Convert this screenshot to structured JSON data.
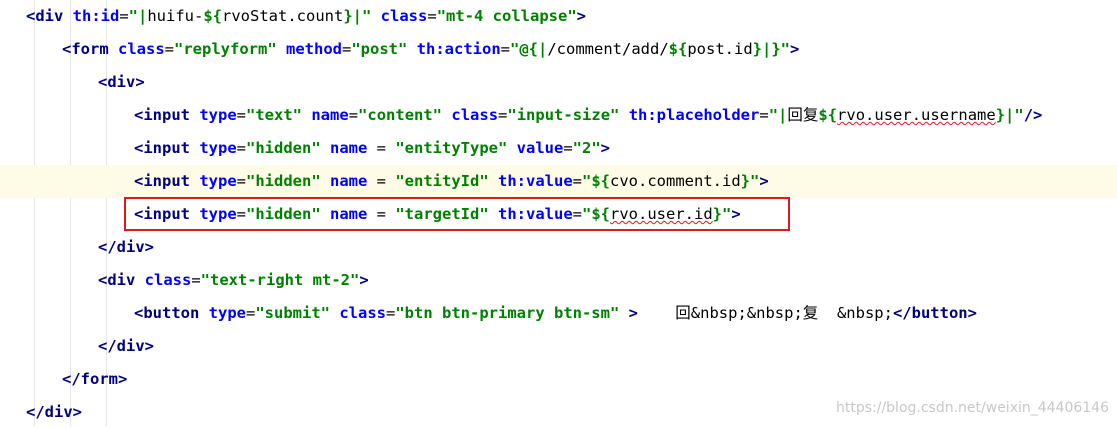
{
  "editor": {
    "lines": [
      {
        "indent": 0,
        "parts": [
          {
            "cls": "tag",
            "text": "<div"
          },
          {
            "cls": "attr",
            "text": " th:id"
          },
          {
            "cls": "plain",
            "text": "="
          },
          {
            "cls": "val",
            "text": "\"|"
          },
          {
            "cls": "expr",
            "text": "huifu-"
          },
          {
            "cls": "val",
            "text": "${"
          },
          {
            "cls": "expr",
            "text": "rvoStat.count"
          },
          {
            "cls": "val",
            "text": "}|\""
          },
          {
            "cls": "attr",
            "text": " class"
          },
          {
            "cls": "plain",
            "text": "="
          },
          {
            "cls": "val",
            "text": "\"mt-4 collapse\""
          },
          {
            "cls": "tag",
            "text": ">"
          }
        ]
      },
      {
        "indent": 1,
        "parts": [
          {
            "cls": "tag",
            "text": "<form"
          },
          {
            "cls": "attr",
            "text": " class"
          },
          {
            "cls": "plain",
            "text": "="
          },
          {
            "cls": "val",
            "text": "\"replyform\""
          },
          {
            "cls": "attr",
            "text": " method"
          },
          {
            "cls": "plain",
            "text": "="
          },
          {
            "cls": "val",
            "text": "\"post\""
          },
          {
            "cls": "attr",
            "text": " th:action"
          },
          {
            "cls": "plain",
            "text": "="
          },
          {
            "cls": "val",
            "text": "\"@{|"
          },
          {
            "cls": "expr",
            "text": "/comment/add/"
          },
          {
            "cls": "val",
            "text": "${"
          },
          {
            "cls": "expr",
            "text": "post.id"
          },
          {
            "cls": "val",
            "text": "}|}\""
          },
          {
            "cls": "tag",
            "text": ">"
          }
        ]
      },
      {
        "indent": 2,
        "parts": [
          {
            "cls": "tag",
            "text": "<div>"
          }
        ]
      },
      {
        "indent": 3,
        "parts": [
          {
            "cls": "tag",
            "text": "<input"
          },
          {
            "cls": "attr",
            "text": " type"
          },
          {
            "cls": "plain",
            "text": "="
          },
          {
            "cls": "val",
            "text": "\"text\""
          },
          {
            "cls": "attr",
            "text": " name"
          },
          {
            "cls": "plain",
            "text": "="
          },
          {
            "cls": "val",
            "text": "\"content\""
          },
          {
            "cls": "attr",
            "text": " class"
          },
          {
            "cls": "plain",
            "text": "="
          },
          {
            "cls": "val",
            "text": "\"input-size\""
          },
          {
            "cls": "attr",
            "text": " th:placeholder"
          },
          {
            "cls": "plain",
            "text": "="
          },
          {
            "cls": "val",
            "text": "\"|"
          },
          {
            "cls": "expr",
            "text": "回复"
          },
          {
            "cls": "val",
            "text": "${"
          },
          {
            "cls": "expr squig",
            "text": "rvo.user.username"
          },
          {
            "cls": "val",
            "text": "}|\""
          },
          {
            "cls": "tag",
            "text": "/>"
          }
        ]
      },
      {
        "indent": 3,
        "parts": [
          {
            "cls": "tag",
            "text": "<input"
          },
          {
            "cls": "attr",
            "text": " type"
          },
          {
            "cls": "plain",
            "text": "="
          },
          {
            "cls": "val",
            "text": "\"hidden\""
          },
          {
            "cls": "attr",
            "text": " name"
          },
          {
            "cls": "plain",
            "text": " = "
          },
          {
            "cls": "val",
            "text": "\"entityType\""
          },
          {
            "cls": "attr",
            "text": " value"
          },
          {
            "cls": "plain",
            "text": "="
          },
          {
            "cls": "val",
            "text": "\"2\""
          },
          {
            "cls": "tag",
            "text": ">"
          }
        ]
      },
      {
        "indent": 3,
        "highlight": true,
        "parts": [
          {
            "cls": "tag",
            "text": "<input"
          },
          {
            "cls": "attr",
            "text": " type"
          },
          {
            "cls": "plain",
            "text": "="
          },
          {
            "cls": "val",
            "text": "\"hidden\""
          },
          {
            "cls": "attr",
            "text": " name"
          },
          {
            "cls": "plain",
            "text": " = "
          },
          {
            "cls": "val",
            "text": "\"entityId\""
          },
          {
            "cls": "attr",
            "text": " th:value"
          },
          {
            "cls": "plain",
            "text": "="
          },
          {
            "cls": "val",
            "text": "\"${"
          },
          {
            "cls": "expr",
            "text": "cvo.comment.id"
          },
          {
            "cls": "val",
            "text": "}\""
          },
          {
            "cls": "tag",
            "text": ">"
          }
        ]
      },
      {
        "indent": 3,
        "parts": [
          {
            "cls": "tag",
            "text": "<input"
          },
          {
            "cls": "attr",
            "text": " type"
          },
          {
            "cls": "plain",
            "text": "="
          },
          {
            "cls": "val",
            "text": "\"hidden\""
          },
          {
            "cls": "attr",
            "text": " name"
          },
          {
            "cls": "plain",
            "text": " = "
          },
          {
            "cls": "val",
            "text": "\"targetId\""
          },
          {
            "cls": "attr",
            "text": " th:value"
          },
          {
            "cls": "plain",
            "text": "="
          },
          {
            "cls": "val",
            "text": "\"${"
          },
          {
            "cls": "expr squig",
            "text": "rvo.user.id"
          },
          {
            "cls": "val",
            "text": "}\""
          },
          {
            "cls": "tag",
            "text": ">"
          }
        ]
      },
      {
        "indent": 2,
        "parts": [
          {
            "cls": "tag",
            "text": "</div>"
          }
        ]
      },
      {
        "indent": 2,
        "parts": [
          {
            "cls": "tag",
            "text": "<div"
          },
          {
            "cls": "attr",
            "text": " class"
          },
          {
            "cls": "plain",
            "text": "="
          },
          {
            "cls": "val",
            "text": "\"text-right mt-2\""
          },
          {
            "cls": "tag",
            "text": ">"
          }
        ]
      },
      {
        "indent": 3,
        "parts": [
          {
            "cls": "tag",
            "text": "<button"
          },
          {
            "cls": "attr",
            "text": " type"
          },
          {
            "cls": "plain",
            "text": "="
          },
          {
            "cls": "val",
            "text": "\"submit\""
          },
          {
            "cls": "attr",
            "text": " class"
          },
          {
            "cls": "plain",
            "text": "="
          },
          {
            "cls": "val",
            "text": "\"btn btn-primary btn-sm\""
          },
          {
            "cls": "tag",
            "text": " >"
          },
          {
            "cls": "plain",
            "text": "    回&nbsp;&nbsp;复  &nbsp;"
          },
          {
            "cls": "tag",
            "text": "</button>"
          }
        ]
      },
      {
        "indent": 2,
        "parts": [
          {
            "cls": "tag",
            "text": "</div>"
          }
        ]
      },
      {
        "indent": 1,
        "parts": [
          {
            "cls": "tag",
            "text": "</form>"
          }
        ]
      },
      {
        "indent": 0,
        "parts": [
          {
            "cls": "tag",
            "text": "</div>"
          }
        ]
      }
    ],
    "selected_line_index": 6
  },
  "watermark": "https://blog.csdn.net/weixin_44406146"
}
